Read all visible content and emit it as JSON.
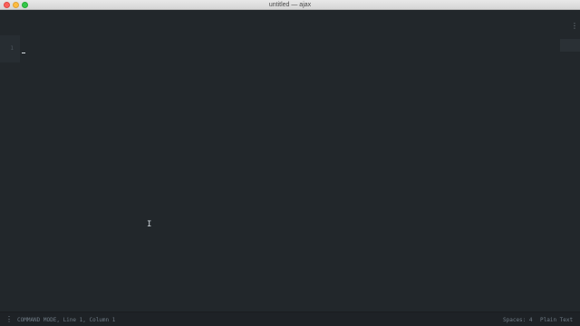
{
  "window": {
    "title": "untitled — ajax"
  },
  "editor": {
    "line_numbers": [
      "1"
    ],
    "text": "",
    "watermark_text": "",
    "menu_icon": "vertical-ellipsis-icon"
  },
  "statusbar": {
    "menu_icon": "vertical-ellipsis-icon",
    "mode": "COMMAND MODE, Line 1, Column 1",
    "spaces": "Spaces: 4",
    "syntax": "Plain Text"
  },
  "colors": {
    "editor_background": "#22272b",
    "titlebar_background": "#e0e0e0",
    "close_button": "#fc605c",
    "minimize_button": "#fdbc40",
    "maximize_button": "#34c84a"
  }
}
